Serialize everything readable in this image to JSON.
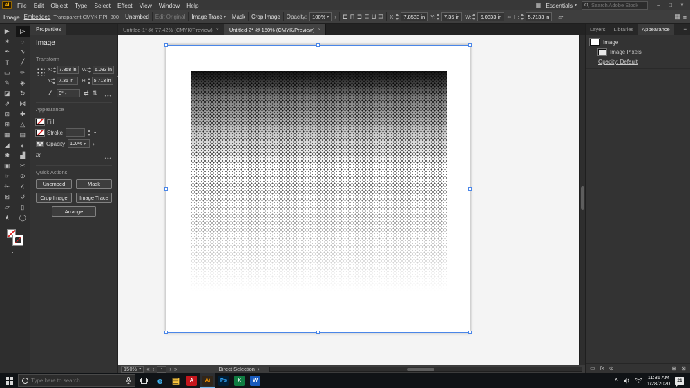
{
  "colors": {
    "selection_blue": "#4a86e8",
    "ai_orange": "#ff9a00",
    "taskbar_active": "#76b9ed"
  },
  "icons": {
    "caret": "▾",
    "panel_arrow": "›",
    "more": "•••",
    "link": "∞",
    "angle": "∠",
    "flip_h": "⇄",
    "flip_v": "⇅",
    "menu": "≡",
    "grid": "▦",
    "dots": "⋯",
    "shear": "▱",
    "tab_close": "×"
  },
  "titlebar": {
    "logo": "Ai",
    "menus": [
      {
        "name": "menu-file",
        "label": "File"
      },
      {
        "name": "menu-edit",
        "label": "Edit"
      },
      {
        "name": "menu-object",
        "label": "Object"
      },
      {
        "name": "menu-type",
        "label": "Type"
      },
      {
        "name": "menu-select",
        "label": "Select"
      },
      {
        "name": "menu-effect",
        "label": "Effect"
      },
      {
        "name": "menu-view",
        "label": "View"
      },
      {
        "name": "menu-window",
        "label": "Window"
      },
      {
        "name": "menu-help",
        "label": "Help"
      }
    ],
    "workspace": "Essentials",
    "search_placeholder": "Search Adobe Stock",
    "window": {
      "minimize": "–",
      "restore": "□",
      "close": "×"
    }
  },
  "controlbar": {
    "selection_label": "Image",
    "embedded": "Embedded",
    "meta": "Transparent CMYK PPI: 300",
    "unembed": "Unembed",
    "edit_original": "Edit Original",
    "image_trace": "Image Trace",
    "mask": "Mask",
    "crop": "Crop Image",
    "opacity_label": "Opacity:",
    "opacity_value": "100%",
    "x_label": "X:",
    "x_value": "7.8583 in",
    "y_label": "Y:",
    "y_value": "7.35 in",
    "w_label": "W:",
    "w_value": "6.0833 in",
    "h_label": "H:",
    "h_value": "5.7133 in",
    "align_icons": [
      {
        "name": "align-left-icon",
        "glyph": "⊏"
      },
      {
        "name": "align-center-icon",
        "glyph": "⊓"
      },
      {
        "name": "align-right-icon",
        "glyph": "⊐"
      },
      {
        "name": "align-top-icon",
        "glyph": "⊑"
      },
      {
        "name": "align-middle-icon",
        "glyph": "⊔"
      },
      {
        "name": "align-bottom-icon",
        "glyph": "⊒"
      }
    ]
  },
  "toolbar": {
    "tools": [
      {
        "name": "selection-tool",
        "glyph": "▶"
      },
      {
        "name": "direct-selection-tool",
        "glyph": "▷",
        "cls": "active"
      },
      {
        "name": "magic-wand-tool",
        "glyph": "✶"
      },
      {
        "name": "lasso-tool",
        "glyph": "◌"
      },
      {
        "name": "pen-tool",
        "glyph": "✒"
      },
      {
        "name": "curvature-tool",
        "glyph": "∿"
      },
      {
        "name": "type-tool",
        "glyph": "T"
      },
      {
        "name": "line-segment-tool",
        "glyph": "╱"
      },
      {
        "name": "rectangle-tool",
        "glyph": "▭"
      },
      {
        "name": "paintbrush-tool",
        "glyph": "✏"
      },
      {
        "name": "pencil-tool",
        "glyph": "✎"
      },
      {
        "name": "shaper-tool",
        "glyph": "◈"
      },
      {
        "name": "eraser-tool",
        "glyph": "◪"
      },
      {
        "name": "rotate-tool",
        "glyph": "↻"
      },
      {
        "name": "scale-tool",
        "glyph": "⇗"
      },
      {
        "name": "width-tool",
        "glyph": "⋈"
      },
      {
        "name": "free-transform-tool",
        "glyph": "⊡"
      },
      {
        "name": "puppet-warp-tool",
        "glyph": "✚"
      },
      {
        "name": "shape-builder-tool",
        "glyph": "⊞"
      },
      {
        "name": "perspective-grid-tool",
        "glyph": "△"
      },
      {
        "name": "mesh-tool",
        "glyph": "▦"
      },
      {
        "name": "gradient-tool",
        "glyph": "▤"
      },
      {
        "name": "eyedropper-tool",
        "glyph": "◢"
      },
      {
        "name": "blend-tool",
        "glyph": "◐"
      },
      {
        "name": "symbol-sprayer-tool",
        "glyph": "✱"
      },
      {
        "name": "column-graph-tool",
        "glyph": "▟"
      },
      {
        "name": "artboard-tool",
        "glyph": "▣"
      },
      {
        "name": "slice-tool",
        "glyph": "✂"
      },
      {
        "name": "hand-tool",
        "glyph": "☞"
      },
      {
        "name": "zoom-tool",
        "glyph": "⊙"
      },
      {
        "name": "knife-tool",
        "glyph": "✁"
      },
      {
        "name": "measure-tool",
        "glyph": "∡"
      },
      {
        "name": "crop-tool",
        "glyph": "⊠"
      },
      {
        "name": "rotate-view-tool",
        "glyph": "↺"
      },
      {
        "name": "print-tiling-tool",
        "glyph": "▱"
      },
      {
        "name": "page-tool",
        "glyph": "▯"
      },
      {
        "name": "star-tool",
        "glyph": "★"
      },
      {
        "name": "ellipse-tool",
        "glyph": "◯"
      }
    ]
  },
  "properties": {
    "tab": "Properties",
    "title": "Image",
    "transform": {
      "section": "Transform",
      "x_label": "X:",
      "x": "7.858 in",
      "y_label": "Y:",
      "y": "7.35 in",
      "w_label": "W:",
      "w": "6.083 in",
      "h_label": "H:",
      "h": "5.713 in",
      "rotate": "0°"
    },
    "appearance": {
      "section": "Appearance",
      "fill_label": "Fill",
      "stroke_label": "Stroke",
      "opacity_label": "Opacity",
      "opacity": "100%",
      "fx": "fx."
    },
    "quick": {
      "section": "Quick Actions",
      "buttons": [
        {
          "name": "unembed-button",
          "label": "Unembed"
        },
        {
          "name": "mask-button",
          "label": "Mask"
        },
        {
          "name": "crop-image-button",
          "label": "Crop Image"
        },
        {
          "name": "image-trace-button",
          "label": "Image Trace"
        },
        {
          "name": "arrange-button",
          "label": "Arrange",
          "cls": "wide"
        }
      ]
    }
  },
  "tabs": [
    {
      "name": "document-tab-1",
      "label": "Untitled-1* @ 77.42% (CMYK/Preview)"
    },
    {
      "name": "document-tab-2",
      "label": "Untitled-2* @ 150% (CMYK/Preview)",
      "cls": "active"
    }
  ],
  "statusbar": {
    "zoom": "150%",
    "nav_first": "«",
    "nav_prev": "‹",
    "artboard": "1",
    "nav_next": "›",
    "nav_last": "»",
    "status": "Direct Selection"
  },
  "rightdock": {
    "tabs": [
      {
        "name": "tab-layers",
        "label": "Layers"
      },
      {
        "name": "tab-libraries",
        "label": "Libraries"
      },
      {
        "name": "tab-appearance",
        "label": "Appearance",
        "cls": "active"
      }
    ],
    "rows": {
      "image": "Image",
      "pixels": "Image Pixels",
      "opacity": "Opacity: Default"
    },
    "bottom_icons": [
      {
        "name": "add-new-stroke-icon",
        "glyph": "▭"
      },
      {
        "name": "add-new-effect-icon",
        "glyph": "fx"
      },
      {
        "name": "clear-appearance-icon",
        "glyph": "⊘"
      },
      {
        "name": "duplicate-item-icon",
        "glyph": "⊞",
        "cls": "push"
      },
      {
        "name": "delete-item-icon",
        "glyph": "⊠"
      }
    ]
  },
  "taskbar": {
    "search_placeholder": "Type here to search",
    "chevron": "^",
    "apps": [
      {
        "name": "edge-icon",
        "glyph": "e",
        "color": "#40b3f0",
        "bg": "transparent",
        "fs": "13px"
      },
      {
        "name": "file-explorer-icon",
        "glyph": "▤",
        "color": "#ffc83d",
        "bg": "transparent",
        "fs": "12px"
      },
      {
        "name": "acrobat-icon",
        "glyph": "A",
        "color": "#ffffff",
        "bg": "#c4161c"
      },
      {
        "name": "illustrator-icon",
        "glyph": "Ai",
        "color": "#ff9a00",
        "bg": "#31261a",
        "cls": "active"
      },
      {
        "name": "photoshop-icon",
        "glyph": "Ps",
        "color": "#31a8ff",
        "bg": "#001e36"
      },
      {
        "name": "excel-icon",
        "glyph": "X",
        "color": "#ffffff",
        "bg": "#107c41"
      },
      {
        "name": "word-icon",
        "glyph": "W",
        "color": "#ffffff",
        "bg": "#185abd"
      }
    ],
    "time": "11:31 AM",
    "date": "1/28/2020",
    "badge": "21"
  }
}
